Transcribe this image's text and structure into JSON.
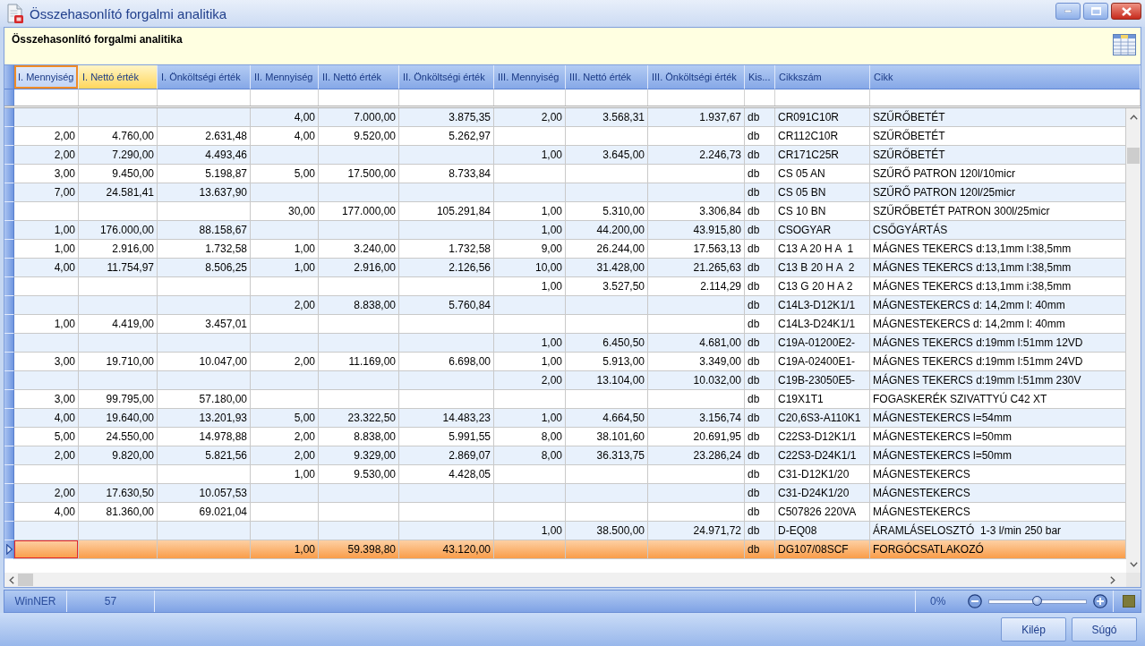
{
  "window": {
    "title": "Összehasonlító forgalmi analitika"
  },
  "info_panel": {
    "title": "Összehasonlító forgalmi analitika"
  },
  "table": {
    "columns": [
      {
        "label": "I. Mennyiség",
        "kind": "number",
        "focused": true,
        "hovered": false
      },
      {
        "label": "I. Nettó érték",
        "kind": "number",
        "focused": false,
        "hovered": true
      },
      {
        "label": "I. Önköltségi érték",
        "kind": "number",
        "focused": false,
        "hovered": false
      },
      {
        "label": "II. Mennyiség",
        "kind": "number",
        "focused": false,
        "hovered": false
      },
      {
        "label": "II. Nettó érték",
        "kind": "number",
        "focused": false,
        "hovered": false
      },
      {
        "label": "II. Önköltségi érték",
        "kind": "number",
        "focused": false,
        "hovered": false
      },
      {
        "label": "III. Mennyiség",
        "kind": "number",
        "focused": false,
        "hovered": false
      },
      {
        "label": "III. Nettó érték",
        "kind": "number",
        "focused": false,
        "hovered": false
      },
      {
        "label": "III. Önköltségi érték",
        "kind": "number",
        "focused": false,
        "hovered": false
      },
      {
        "label": "Kis...",
        "kind": "text",
        "focused": false,
        "hovered": false
      },
      {
        "label": "Cikkszám",
        "kind": "text",
        "focused": false,
        "hovered": false
      },
      {
        "label": "Cikk",
        "kind": "text",
        "focused": false,
        "hovered": false
      }
    ],
    "rows": [
      {
        "selected": false,
        "cells": [
          null,
          null,
          null,
          "4,00",
          "7.000,00",
          "3.875,35",
          "2,00",
          "3.568,31",
          "1.937,67",
          "db",
          "CR091C10R",
          "SZŰRŐBETÉT"
        ]
      },
      {
        "selected": false,
        "cells": [
          "2,00",
          "4.760,00",
          "2.631,48",
          "4,00",
          "9.520,00",
          "5.262,97",
          null,
          null,
          null,
          "db",
          "CR112C10R",
          "SZŰRŐBETÉT"
        ]
      },
      {
        "selected": false,
        "cells": [
          "2,00",
          "7.290,00",
          "4.493,46",
          null,
          null,
          null,
          "1,00",
          "3.645,00",
          "2.246,73",
          "db",
          "CR171C25R",
          "SZŰRŐBETÉT"
        ]
      },
      {
        "selected": false,
        "cells": [
          "3,00",
          "9.450,00",
          "5.198,87",
          "5,00",
          "17.500,00",
          "8.733,84",
          null,
          null,
          null,
          "db",
          "CS 05 AN",
          "SZŰRŐ PATRON 120l/10micr"
        ]
      },
      {
        "selected": false,
        "cells": [
          "7,00",
          "24.581,41",
          "13.637,90",
          null,
          null,
          null,
          null,
          null,
          null,
          "db",
          "CS 05 BN",
          "SZŰRŐ PATRON 120l/25micr"
        ]
      },
      {
        "selected": false,
        "cells": [
          null,
          null,
          null,
          "30,00",
          "177.000,00",
          "105.291,84",
          "1,00",
          "5.310,00",
          "3.306,84",
          "db",
          "CS 10 BN",
          "SZŰRŐBETÉT PATRON 300l/25micr"
        ]
      },
      {
        "selected": false,
        "cells": [
          "1,00",
          "176.000,00",
          "88.158,67",
          null,
          null,
          null,
          "1,00",
          "44.200,00",
          "43.915,80",
          "db",
          "CSOGYAR",
          "CSŐGYÁRTÁS"
        ]
      },
      {
        "selected": false,
        "cells": [
          "1,00",
          "2.916,00",
          "1.732,58",
          "1,00",
          "3.240,00",
          "1.732,58",
          "9,00",
          "26.244,00",
          "17.563,13",
          "db",
          "C13 A 20 H A  1",
          "MÁGNES TEKERCS d:13,1mm l:38,5mm"
        ]
      },
      {
        "selected": false,
        "cells": [
          "4,00",
          "11.754,97",
          "8.506,25",
          "1,00",
          "2.916,00",
          "2.126,56",
          "10,00",
          "31.428,00",
          "21.265,63",
          "db",
          "C13 B 20 H A  2",
          "MÁGNES TEKERCS d:13,1mm l:38,5mm"
        ]
      },
      {
        "selected": false,
        "cells": [
          null,
          null,
          null,
          null,
          null,
          null,
          "1,00",
          "3.527,50",
          "2.114,29",
          "db",
          "C13 G 20 H A 2",
          "MÁGNES TEKERCS d:13,1mm i:38,5mm"
        ]
      },
      {
        "selected": false,
        "cells": [
          null,
          null,
          null,
          "2,00",
          "8.838,00",
          "5.760,84",
          null,
          null,
          null,
          "db",
          "C14L3-D12K1/1",
          "MÁGNESTEKERCS d: 14,2mm l: 40mm"
        ]
      },
      {
        "selected": false,
        "cells": [
          "1,00",
          "4.419,00",
          "3.457,01",
          null,
          null,
          null,
          null,
          null,
          null,
          "db",
          "C14L3-D24K1/1",
          "MÁGNESTEKERCS d: 14,2mm l: 40mm"
        ]
      },
      {
        "selected": false,
        "cells": [
          null,
          null,
          null,
          null,
          null,
          null,
          "1,00",
          "6.450,50",
          "4.681,00",
          "db",
          "C19A-01200E2-",
          "MÁGNES TEKERCS d:19mm l:51mm 12VD"
        ]
      },
      {
        "selected": false,
        "cells": [
          "3,00",
          "19.710,00",
          "10.047,00",
          "2,00",
          "11.169,00",
          "6.698,00",
          "1,00",
          "5.913,00",
          "3.349,00",
          "db",
          "C19A-02400E1-",
          "MÁGNES TEKERCS d:19mm l:51mm 24VD"
        ]
      },
      {
        "selected": false,
        "cells": [
          null,
          null,
          null,
          null,
          null,
          null,
          "2,00",
          "13.104,00",
          "10.032,00",
          "db",
          "C19B-23050E5-",
          "MÁGNES TEKERCS d:19mm l:51mm 230V"
        ]
      },
      {
        "selected": false,
        "cells": [
          "3,00",
          "99.795,00",
          "57.180,00",
          null,
          null,
          null,
          null,
          null,
          null,
          "db",
          "C19X1T1",
          "FOGASKERÉK SZIVATTYÚ C42 XT"
        ]
      },
      {
        "selected": false,
        "cells": [
          "4,00",
          "19.640,00",
          "13.201,93",
          "5,00",
          "23.322,50",
          "14.483,23",
          "1,00",
          "4.664,50",
          "3.156,74",
          "db",
          "C20,6S3-A110K1",
          "MÁGNESTEKERCS l=54mm"
        ]
      },
      {
        "selected": false,
        "cells": [
          "5,00",
          "24.550,00",
          "14.978,88",
          "2,00",
          "8.838,00",
          "5.991,55",
          "8,00",
          "38.101,60",
          "20.691,95",
          "db",
          "C22S3-D12K1/1",
          "MÁGNESTEKERCS l=50mm"
        ]
      },
      {
        "selected": false,
        "cells": [
          "2,00",
          "9.820,00",
          "5.821,56",
          "2,00",
          "9.329,00",
          "2.869,07",
          "8,00",
          "36.313,75",
          "23.286,24",
          "db",
          "C22S3-D24K1/1",
          "MÁGNESTEKERCS l=50mm"
        ]
      },
      {
        "selected": false,
        "cells": [
          null,
          null,
          null,
          "1,00",
          "9.530,00",
          "4.428,05",
          null,
          null,
          null,
          "db",
          "C31-D12K1/20",
          "MÁGNESTEKERCS"
        ]
      },
      {
        "selected": false,
        "cells": [
          "2,00",
          "17.630,50",
          "10.057,53",
          null,
          null,
          null,
          null,
          null,
          null,
          "db",
          "C31-D24K1/20",
          "MÁGNESTEKERCS"
        ]
      },
      {
        "selected": false,
        "cells": [
          "4,00",
          "81.360,00",
          "69.021,04",
          null,
          null,
          null,
          null,
          null,
          null,
          "db",
          "C507826 220VA",
          "MÁGNESTEKERCS"
        ]
      },
      {
        "selected": false,
        "cells": [
          null,
          null,
          null,
          null,
          null,
          null,
          "1,00",
          "38.500,00",
          "24.971,72",
          "db",
          "D-EQ08",
          "ÁRAMLÁSELOSZTÓ  1-3 l/min 250 bar"
        ]
      },
      {
        "selected": true,
        "cells": [
          null,
          null,
          null,
          "1,00",
          "59.398,80",
          "43.120,00",
          null,
          null,
          null,
          "db",
          "DG107/08SCF",
          "FORGÓCSATLAKOZÓ"
        ]
      }
    ]
  },
  "status_bar": {
    "panels": [
      "WinNER",
      "57"
    ],
    "zoom": {
      "label": "0%",
      "level": 0.5
    }
  },
  "buttons": [
    "Kilép",
    "Súgó"
  ]
}
